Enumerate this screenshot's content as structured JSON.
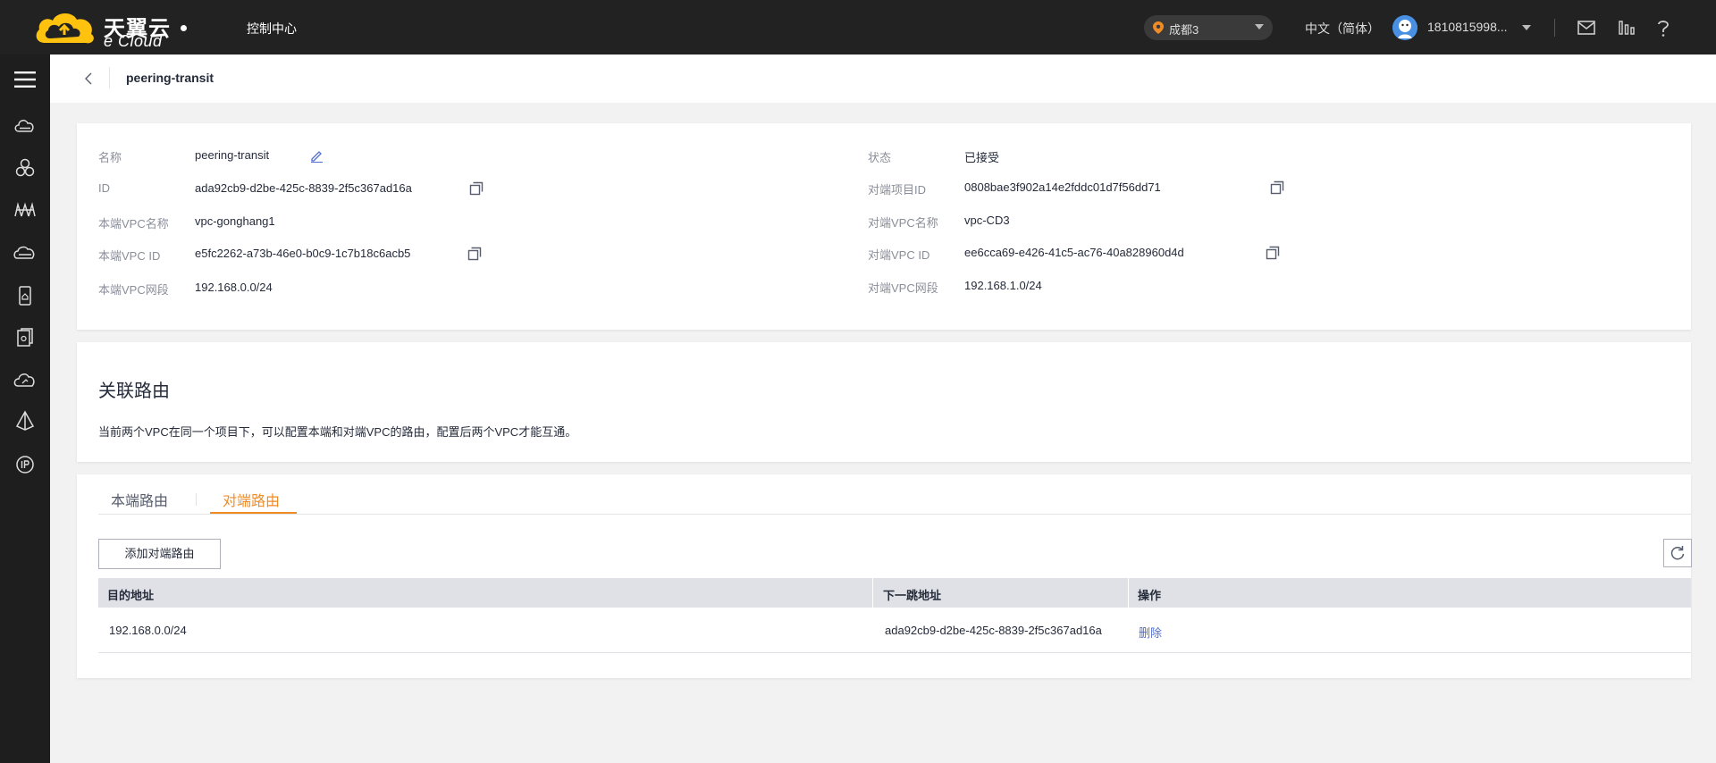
{
  "header": {
    "logo_cn": "天翼云",
    "logo_en": "e Cloud",
    "console_label": "控制中心",
    "region": "成都3",
    "language": "中文（简体）",
    "user": "1810815998..."
  },
  "rail": {
    "items": [
      "menu-icon",
      "cloud-server-icon",
      "cluster-icon",
      "network-icon",
      "storage-icon",
      "mobile-icon",
      "device-icon",
      "cloud-refresh-icon",
      "vpn-icon",
      "eip-icon"
    ]
  },
  "breadcrumb": {
    "title": "peering-transit"
  },
  "info": {
    "left": [
      {
        "key": "名称",
        "value": "peering-transit"
      },
      {
        "key": "ID",
        "value": "ada92cb9-d2be-425c-8839-2f5c367ad16a"
      },
      {
        "key": "本端VPC名称",
        "value": "vpc-gonghang1"
      },
      {
        "key": "本端VPC ID",
        "value": "e5fc2262-a73b-46e0-b0c9-1c7b18c6acb5"
      },
      {
        "key": "本端VPC网段",
        "value": "192.168.0.0/24"
      }
    ],
    "right": [
      {
        "key": "状态",
        "value": "已接受"
      },
      {
        "key": "对端项目ID",
        "value": "0808bae3f902a14e2fddc01d7f56dd71"
      },
      {
        "key": "对端VPC名称",
        "value": "vpc-CD3"
      },
      {
        "key": "对端VPC ID",
        "value": "ee6cca69-e426-41c5-ac76-40a828960d4d"
      },
      {
        "key": "对端VPC网段",
        "value": "192.168.1.0/24"
      }
    ]
  },
  "route_section": {
    "title": "关联路由",
    "description": "当前两个VPC在同一个项目下，可以配置本端和对端VPC的路由，配置后两个VPC才能互通。"
  },
  "tabs": {
    "local": "本端路由",
    "peer": "对端路由",
    "active": "peer"
  },
  "table": {
    "add_button": "添加对端路由",
    "columns": [
      "目的地址",
      "下一跳地址",
      "操作"
    ],
    "rows": [
      {
        "destination": "192.168.0.0/24",
        "next_hop": "ada92cb9-d2be-425c-8839-2f5c367ad16a",
        "action": "删除"
      }
    ]
  },
  "colors": {
    "topbar": "#222222",
    "rail": "#1e1e1e",
    "accent_orange": "#f08c26",
    "link_blue": "#526ecc"
  }
}
